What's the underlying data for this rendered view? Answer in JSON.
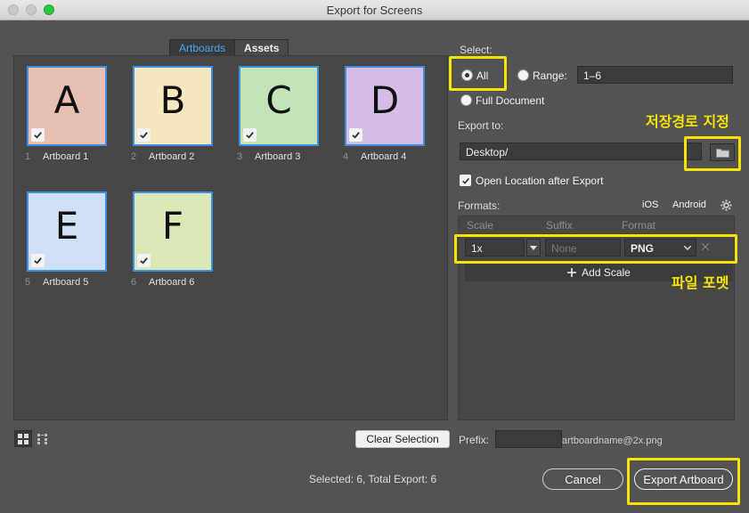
{
  "window": {
    "title": "Export for Screens"
  },
  "tabs": [
    {
      "label": "Artboards",
      "active": true
    },
    {
      "label": "Assets",
      "active": false
    }
  ],
  "artboards": [
    {
      "num": "1",
      "name": "Artboard 1",
      "letter": "A",
      "color": "#e8c0b3",
      "checked": true
    },
    {
      "num": "2",
      "name": "Artboard 2",
      "letter": "B",
      "color": "#f6e7be",
      "checked": true
    },
    {
      "num": "3",
      "name": "Artboard 3",
      "letter": "C",
      "color": "#c3e3b8",
      "checked": true
    },
    {
      "num": "4",
      "name": "Artboard 4",
      "letter": "D",
      "color": "#d5bde6",
      "checked": true
    },
    {
      "num": "5",
      "name": "Artboard 5",
      "letter": "E",
      "color": "#cfe0f6",
      "checked": true
    },
    {
      "num": "6",
      "name": "Artboard 6",
      "letter": "F",
      "color": "#dce7b8",
      "checked": true
    }
  ],
  "select": {
    "label": "Select:",
    "all_label": "All",
    "range_label": "Range:",
    "range_value": "1–6",
    "full_doc_label": "Full Document",
    "selected": "all"
  },
  "export_to": {
    "label": "Export to:",
    "path": "Desktop/",
    "open_location_label": "Open Location after Export",
    "open_location_checked": true
  },
  "formats": {
    "label": "Formats:",
    "ios_label": "iOS",
    "android_label": "Android",
    "columns": {
      "scale": "Scale",
      "suffix": "Suffix",
      "format": "Format"
    },
    "row": {
      "scale": "1x",
      "suffix_placeholder": "None",
      "format": "PNG"
    },
    "add_scale_label": "Add Scale"
  },
  "prefix": {
    "label": "Prefix:",
    "value": "",
    "preview": "artboardname@2x.png"
  },
  "footer": {
    "clear_selection": "Clear Selection",
    "status": "Selected: 6, Total Export: 6",
    "cancel": "Cancel",
    "export": "Export Artboard"
  },
  "annotations": {
    "save_path": "저장경로 지정",
    "file_format": "파일 포멧"
  },
  "colors": {
    "highlight": "#f5e400",
    "accent": "#3b8fe5",
    "panel": "#535353"
  }
}
